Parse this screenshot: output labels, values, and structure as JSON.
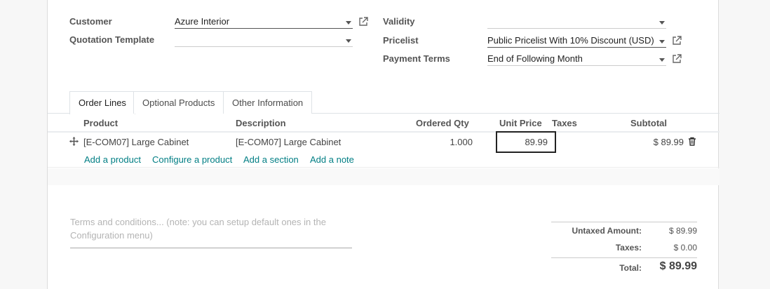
{
  "form": {
    "customer_label": "Customer",
    "customer_value": "Azure Interior",
    "template_label": "Quotation Template",
    "template_value": "",
    "validity_label": "Validity",
    "validity_value": "",
    "pricelist_label": "Pricelist",
    "pricelist_value": "Public Pricelist With 10% Discount (USD)",
    "payment_terms_label": "Payment Terms",
    "payment_terms_value": "End of Following Month"
  },
  "tabs": [
    {
      "label": "Order Lines"
    },
    {
      "label": "Optional Products"
    },
    {
      "label": "Other Information"
    }
  ],
  "table": {
    "headers": [
      "Product",
      "Description",
      "Ordered Qty",
      "Unit Price",
      "Taxes",
      "Subtotal"
    ],
    "rows": [
      {
        "product": "[E-COM07] Large Cabinet",
        "description": "[E-COM07] Large Cabinet",
        "qty": "1.000",
        "unit_price": "89.99",
        "taxes": "",
        "subtotal": "$ 89.99"
      }
    ],
    "actions": [
      "Add a product",
      "Configure a product",
      "Add a section",
      "Add a note"
    ]
  },
  "terms": {
    "placeholder": "Terms and conditions... (note: you can setup default ones in the Configuration menu)"
  },
  "totals": {
    "untaxed_label": "Untaxed Amount:",
    "untaxed_value": "$ 89.99",
    "taxes_label": "Taxes:",
    "taxes_value": "$ 0.00",
    "total_label": "Total:",
    "total_value": "$ 89.99"
  },
  "colors": {
    "link": "#017e84",
    "label": "#555555",
    "border": "#dee2e6"
  }
}
